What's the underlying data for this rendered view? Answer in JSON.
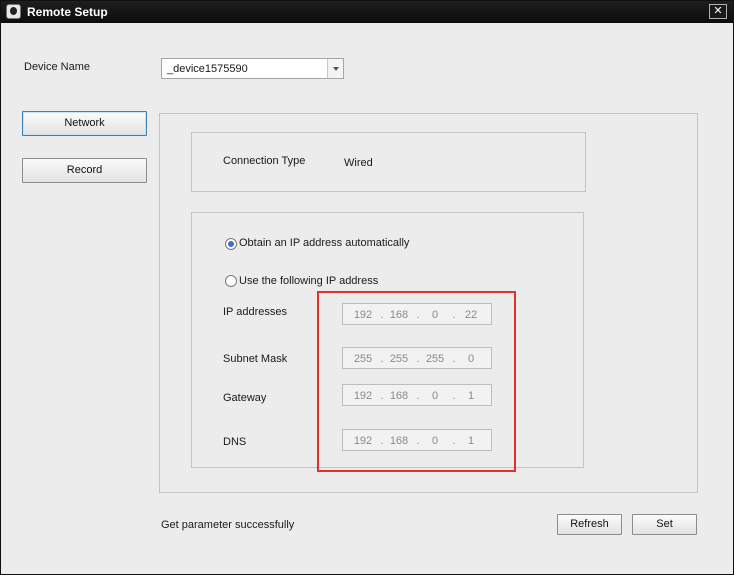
{
  "window": {
    "title": "Remote Setup",
    "close_symbol": "✕"
  },
  "device": {
    "label": "Device Name",
    "value": "_device1575590"
  },
  "nav": {
    "network": "Network",
    "record": "Record"
  },
  "connection": {
    "label": "Connection Type",
    "value": "Wired"
  },
  "ip_mode": {
    "auto_label": "Obtain an IP address automatically",
    "manual_label": "Use the following IP address",
    "selected": "auto"
  },
  "fields": {
    "ip": {
      "label": "IP addresses",
      "octets": [
        "192",
        "168",
        "0",
        "22"
      ]
    },
    "subnet": {
      "label": "Subnet Mask",
      "octets": [
        "255",
        "255",
        "255",
        "0"
      ]
    },
    "gateway": {
      "label": "Gateway",
      "octets": [
        "192",
        "168",
        "0",
        "1"
      ]
    },
    "dns": {
      "label": "DNS",
      "octets": [
        "192",
        "168",
        "0",
        "1"
      ]
    }
  },
  "status": "Get parameter successfully",
  "buttons": {
    "refresh": "Refresh",
    "set": "Set"
  },
  "colors": {
    "highlight": "#e0312f",
    "titlebar": "#111111",
    "radio_selected": "#3a6ed0"
  }
}
